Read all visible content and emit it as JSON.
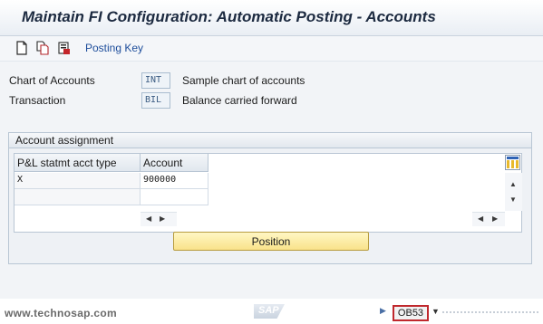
{
  "window": {
    "title": "Maintain FI Configuration: Automatic Posting - Accounts"
  },
  "toolbar": {
    "icons": [
      "new-document-icon",
      "copy-document-icon",
      "save-local-icon"
    ],
    "posting_key_label": "Posting Key"
  },
  "fields": {
    "chart_of_accounts": {
      "label": "Chart of Accounts",
      "value": "INT",
      "description": "Sample chart of accounts"
    },
    "transaction": {
      "label": "Transaction",
      "value": "BIL",
      "description": "Balance carried forward"
    }
  },
  "account_assignment": {
    "title": "Account assignment",
    "columns": [
      "P&L statmt acct type",
      "Account"
    ],
    "rows": [
      {
        "type": "X",
        "account": "900000"
      },
      {
        "type": "",
        "account": ""
      }
    ],
    "position_button": "Position"
  },
  "status_bar": {
    "watermark": "www.technosap.com",
    "logo_text": "SAP",
    "transaction_code": "OB53"
  },
  "colors": {
    "title_text": "#1c2a40",
    "link": "#1d4d9b",
    "position_button": "#f9e28a",
    "tcode_border": "#c0282d"
  }
}
